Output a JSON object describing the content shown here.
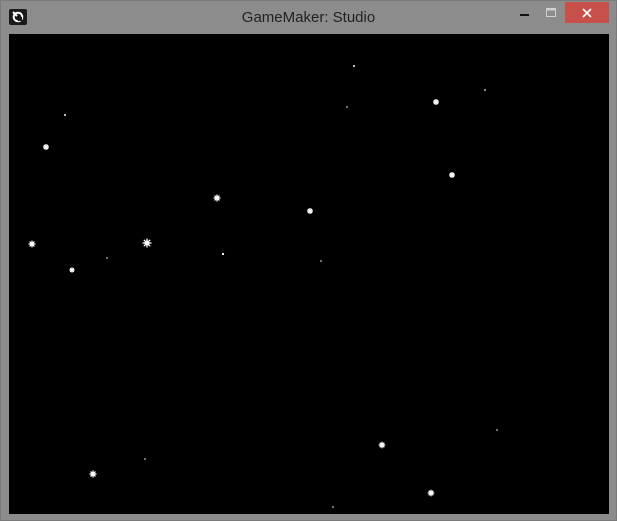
{
  "window": {
    "title": "GameMaker: Studio",
    "app_icon": "gamemaker-logo-icon",
    "controls": {
      "minimize_icon": "minimize-icon",
      "maximize_icon": "maximize-icon",
      "close_icon": "close-icon"
    }
  },
  "colors": {
    "titlebar": "#8c8c8c",
    "close_button": "#c7504a",
    "canvas_background": "#000000",
    "star": "#ffffff"
  }
}
